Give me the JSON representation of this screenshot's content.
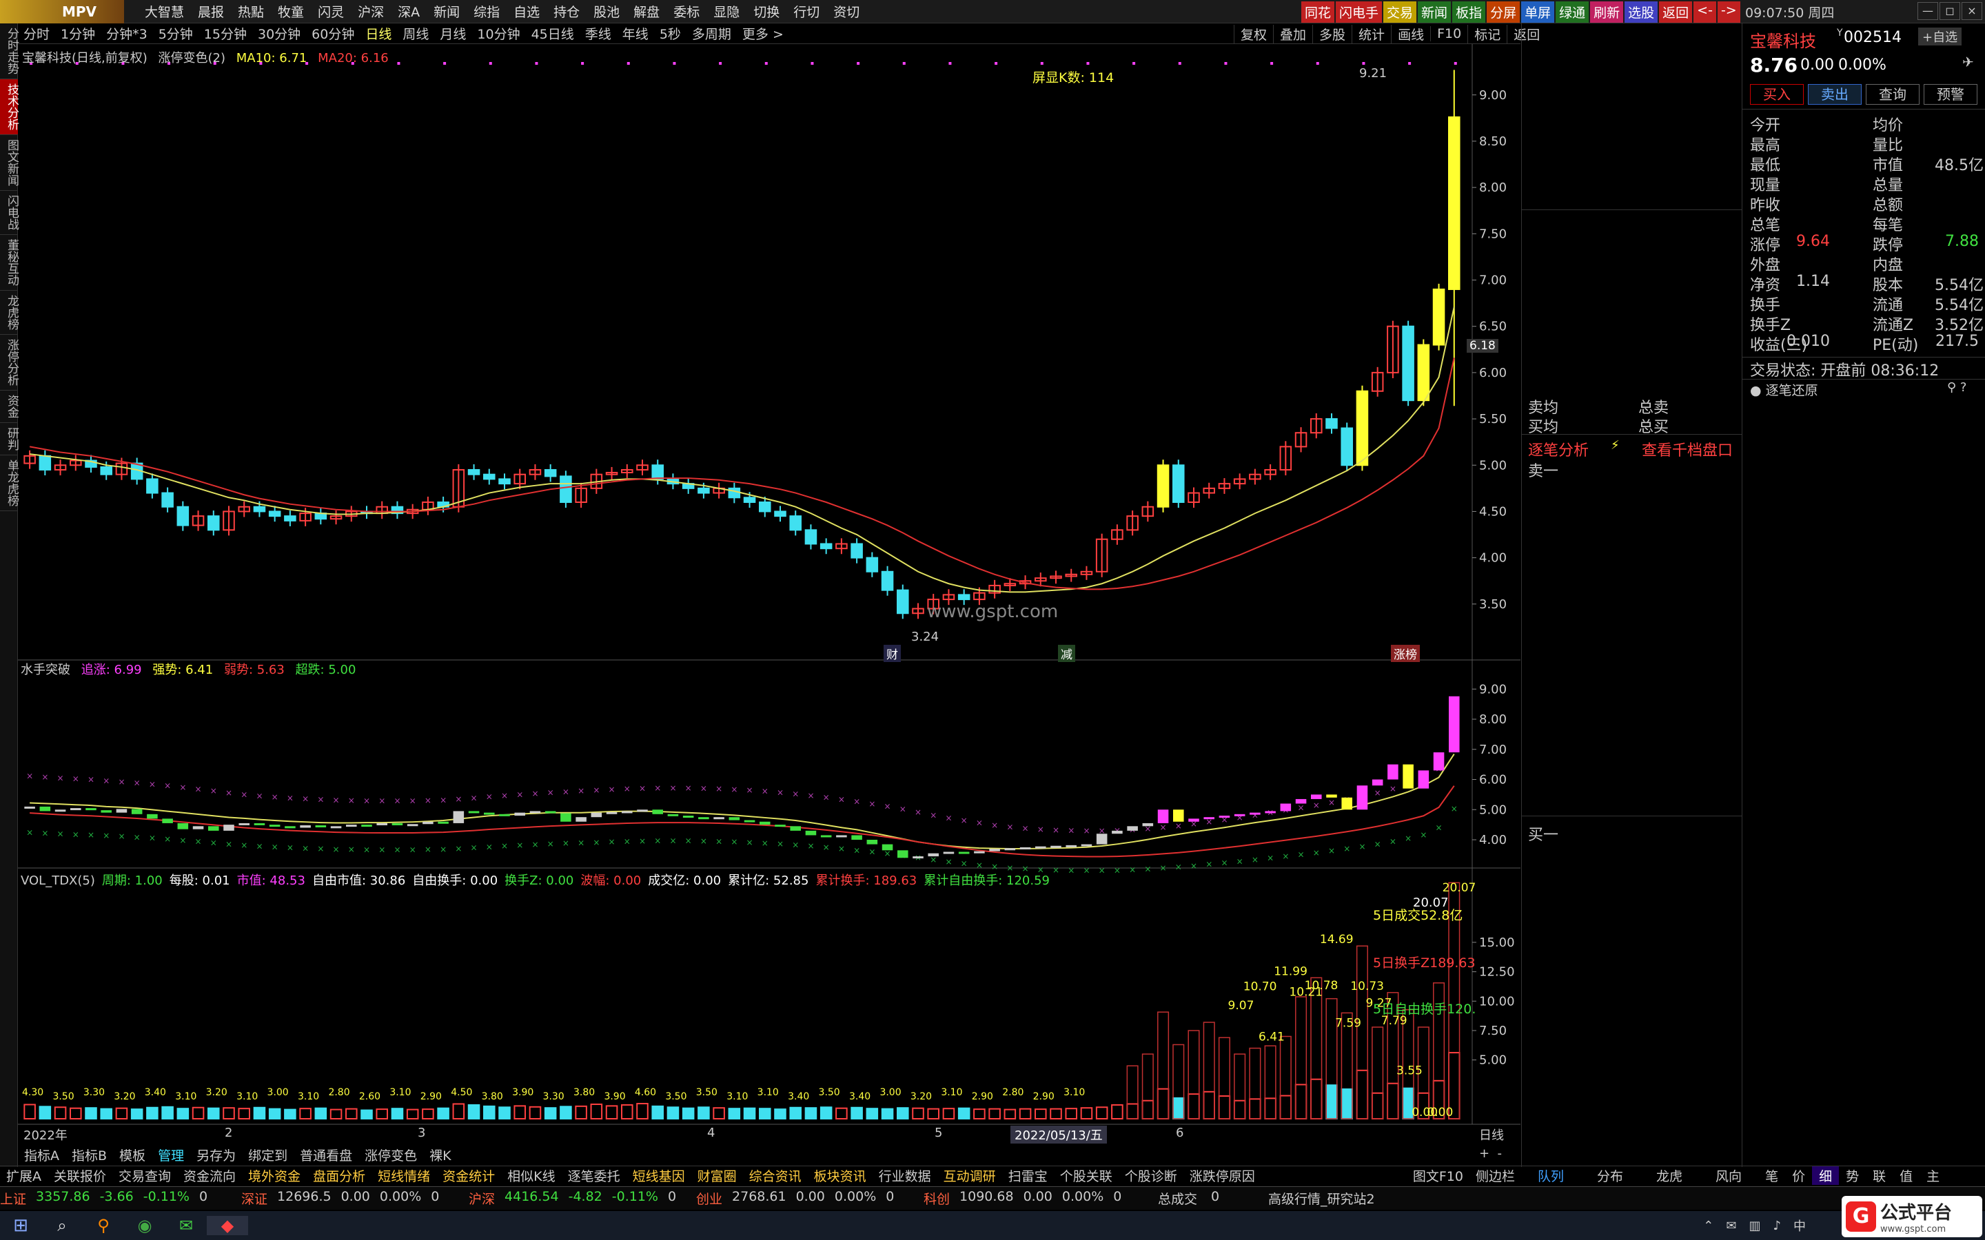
{
  "app": {
    "logo": "MPV",
    "clock": "09:07:50 周四",
    "win_min": "—",
    "win_max": "◻",
    "win_close": "×"
  },
  "menu": [
    "大智慧",
    "晨报",
    "热點",
    "牧童",
    "闪灵",
    "沪深",
    "深A",
    "新闻",
    "综指",
    "自选",
    "持仓",
    "股池",
    "解盘",
    "委标",
    "显隐",
    "切换",
    "行切",
    "资切"
  ],
  "quick": [
    {
      "label": "同花",
      "bg": "#c02020"
    },
    {
      "label": "闪电手",
      "bg": "#c02020"
    },
    {
      "label": "交易",
      "bg": "#c0a000"
    },
    {
      "label": "新闻",
      "bg": "#207020"
    },
    {
      "label": "板指",
      "bg": "#207020"
    },
    {
      "label": "分屏",
      "bg": "#c04000"
    },
    {
      "label": "单屏",
      "bg": "#2060c0"
    },
    {
      "label": "绿通",
      "bg": "#207020"
    },
    {
      "label": "刷新",
      "bg": "#c02060"
    },
    {
      "label": "选股",
      "bg": "#4040c0"
    },
    {
      "label": "返回",
      "bg": "#c02020"
    },
    {
      "label": "<-",
      "bg": "#c02020"
    },
    {
      "label": "->",
      "bg": "#c02020"
    }
  ],
  "vtabs": [
    "分时走势",
    "技术分析",
    "图文新闻",
    "闪电战",
    "董秘互动",
    "龙虎榜",
    "涨停分析",
    "资金",
    "研判",
    "单龙虎榜"
  ],
  "periods": [
    "分时",
    "1分钟",
    "分钟*3",
    "5分钟",
    "15分钟",
    "30分钟",
    "60分钟",
    "日线",
    "周线",
    "月线",
    "10分钟",
    "45日线",
    "季线",
    "年线",
    "5秒",
    "多周期",
    "更多 >"
  ],
  "tools": [
    "复权",
    "叠加",
    "多股",
    "统计",
    "画线",
    "F10",
    "标记",
    "返回"
  ],
  "main": {
    "title": "宝馨科技(日线,前复权)",
    "indicator": "涨停变色(2)",
    "ma10": "MA10: 6.71",
    "ma20": "MA20: 6.16",
    "kcount": "屏显K数: 114",
    "hi_label": "9.21",
    "lo_label": "3.24",
    "price_tag": "6.18",
    "watermark": "www.gspt.com",
    "mark_cai": "财",
    "mark_jian": "减",
    "mark_zt": "涨榜"
  },
  "mid": {
    "title": "水手突破",
    "l1": "追涨: 6.99",
    "l2": "强势: 6.41",
    "l3": "弱势: 5.63",
    "l4": "超跌: 5.00"
  },
  "vol": {
    "items": [
      {
        "t": "VOL_TDX(5)",
        "c": "#ccc"
      },
      {
        "t": "周期: 1.00",
        "c": "#40e040"
      },
      {
        "t": "每股: 0.01",
        "c": "#fff"
      },
      {
        "t": "市值: 48.53",
        "c": "#ff40ff"
      },
      {
        "t": "自由市值: 30.86",
        "c": "#fff"
      },
      {
        "t": "自由换手: 0.00",
        "c": "#fff"
      },
      {
        "t": "换手Z: 0.00",
        "c": "#40e040"
      },
      {
        "t": "波幅: 0.00",
        "c": "#ff4040"
      },
      {
        "t": "成交亿: 0.00",
        "c": "#fff"
      },
      {
        "t": "累计亿: 52.85",
        "c": "#fff"
      },
      {
        "t": "累计换手: 189.63",
        "c": "#ff4040"
      },
      {
        "t": "累计自由换手: 120.59",
        "c": "#40e040"
      }
    ],
    "ann1": "5日成交52.8亿",
    "ann2": "5日换手Z189.63",
    "ann3": "5日自由换手120.",
    "topval": "20.07"
  },
  "xaxis": {
    "labels": [
      "2022年",
      "2",
      "3",
      "4",
      "5",
      "6"
    ],
    "date": "2022/05/13/五",
    "right": "日线"
  },
  "chart_data": [
    {
      "type": "candlestick",
      "title": "宝馨科技(日线,前复权)",
      "yticks": [
        "9.00",
        "8.50",
        "8.00",
        "7.50",
        "7.00",
        "6.50",
        "6.00",
        "5.50",
        "5.00",
        "4.50",
        "4.00",
        "3.50"
      ],
      "ylim": [
        3.0,
        9.4
      ],
      "close": [
        5.1,
        4.95,
        5.0,
        5.05,
        4.98,
        4.9,
        5.02,
        4.85,
        4.7,
        4.55,
        4.35,
        4.45,
        4.3,
        4.5,
        4.55,
        4.5,
        4.45,
        4.4,
        4.48,
        4.42,
        4.45,
        4.5,
        4.48,
        4.55,
        4.48,
        4.52,
        4.6,
        4.55,
        4.95,
        4.9,
        4.85,
        4.8,
        4.9,
        4.95,
        4.88,
        4.6,
        4.75,
        4.9,
        4.92,
        4.95,
        5.0,
        4.85,
        4.8,
        4.75,
        4.7,
        4.75,
        4.65,
        4.6,
        4.5,
        4.45,
        4.3,
        4.15,
        4.1,
        4.15,
        4.0,
        3.85,
        3.65,
        3.4,
        3.45,
        3.55,
        3.6,
        3.55,
        3.62,
        3.7,
        3.72,
        3.75,
        3.78,
        3.8,
        3.82,
        3.85,
        4.2,
        4.3,
        4.45,
        4.55,
        5.0,
        4.6,
        4.7,
        4.75,
        4.8,
        4.85,
        4.9,
        4.95,
        5.2,
        5.35,
        5.5,
        5.4,
        5.0,
        5.8,
        6.0,
        6.5,
        5.7,
        6.3,
        6.9,
        8.76
      ],
      "ma10": [
        5.12,
        5.1,
        5.08,
        5.06,
        5.04,
        5.0,
        4.98,
        4.95,
        4.9,
        4.85,
        4.8,
        4.75,
        4.7,
        4.65,
        4.62,
        4.58,
        4.55,
        4.52,
        4.5,
        4.48,
        4.47,
        4.47,
        4.48,
        4.48,
        4.49,
        4.5,
        4.52,
        4.55,
        4.6,
        4.65,
        4.7,
        4.73,
        4.76,
        4.78,
        4.8,
        4.8,
        4.8,
        4.82,
        4.84,
        4.85,
        4.85,
        4.84,
        4.82,
        4.8,
        4.78,
        4.75,
        4.72,
        4.68,
        4.64,
        4.6,
        4.55,
        4.48,
        4.4,
        4.32,
        4.25,
        4.15,
        4.05,
        3.95,
        3.85,
        3.78,
        3.72,
        3.68,
        3.65,
        3.64,
        3.63,
        3.63,
        3.64,
        3.65,
        3.66,
        3.68,
        3.72,
        3.78,
        3.85,
        3.93,
        4.02,
        4.1,
        4.18,
        4.25,
        4.32,
        4.4,
        4.48,
        4.55,
        4.62,
        4.7,
        4.78,
        4.86,
        4.94,
        5.05,
        5.18,
        5.32,
        5.48,
        5.68,
        5.95,
        6.71
      ],
      "ma20": [
        5.2,
        5.17,
        5.14,
        5.12,
        5.1,
        5.07,
        5.04,
        5.01,
        4.97,
        4.93,
        4.88,
        4.83,
        4.78,
        4.73,
        4.68,
        4.64,
        4.61,
        4.58,
        4.56,
        4.54,
        4.52,
        4.51,
        4.5,
        4.5,
        4.5,
        4.5,
        4.51,
        4.52,
        4.55,
        4.58,
        4.62,
        4.65,
        4.68,
        4.71,
        4.74,
        4.76,
        4.78,
        4.8,
        4.82,
        4.84,
        4.85,
        4.86,
        4.86,
        4.86,
        4.85,
        4.84,
        4.82,
        4.8,
        4.77,
        4.74,
        4.7,
        4.65,
        4.6,
        4.54,
        4.48,
        4.42,
        4.35,
        4.27,
        4.18,
        4.1,
        4.02,
        3.95,
        3.88,
        3.82,
        3.77,
        3.73,
        3.7,
        3.68,
        3.67,
        3.66,
        3.66,
        3.67,
        3.69,
        3.72,
        3.76,
        3.8,
        3.85,
        3.91,
        3.97,
        4.03,
        4.1,
        4.17,
        4.24,
        4.31,
        4.38,
        4.46,
        4.54,
        4.63,
        4.73,
        4.84,
        4.96,
        5.1,
        5.4,
        6.16
      ]
    },
    {
      "type": "indicator",
      "title": "水手突破",
      "yticks": [
        "9.00",
        "8.00",
        "7.00",
        "6.00",
        "5.00",
        "4.00"
      ],
      "ylim": [
        3.2,
        9.6
      ],
      "series": [
        {
          "name": "追涨",
          "last": 6.99
        },
        {
          "name": "强势",
          "last": 6.41
        },
        {
          "name": "弱势",
          "last": 5.63
        },
        {
          "name": "超跌",
          "last": 5.0
        }
      ]
    },
    {
      "type": "bar",
      "title": "VOL_TDX(5)",
      "yticks": [
        "15.00",
        "12.50",
        "10.00",
        "7.50",
        "5.00"
      ],
      "ylim": [
        0,
        20.5
      ],
      "values": [
        4.3,
        3.7,
        3.5,
        3.2,
        3.3,
        3.0,
        3.2,
        2.9,
        3.4,
        3.6,
        3.1,
        3.4,
        3.2,
        3.3,
        3.1,
        3.4,
        3.0,
        2.8,
        3.1,
        3.2,
        2.8,
        3.0,
        2.6,
        2.9,
        3.1,
        2.8,
        2.9,
        3.2,
        4.5,
        4.2,
        3.8,
        3.5,
        3.9,
        3.6,
        3.3,
        3.7,
        3.8,
        4.4,
        3.9,
        4.2,
        4.6,
        3.8,
        3.5,
        3.2,
        3.5,
        3.3,
        3.1,
        3.2,
        3.1,
        2.9,
        3.4,
        3.3,
        3.5,
        3.2,
        3.4,
        3.1,
        3.0,
        3.3,
        3.2,
        3.0,
        3.1,
        3.2,
        2.9,
        3.0,
        2.8,
        3.0,
        2.9,
        3.0,
        3.1,
        3.3,
        3.5,
        4.2,
        4.5,
        5.5,
        9.07,
        6.3,
        7.5,
        8.2,
        6.9,
        5.5,
        6.0,
        6.2,
        7.0,
        10.37,
        11.99,
        10.21,
        9.0,
        14.69,
        7.79,
        10.73,
        9.27,
        7.79,
        11.55,
        20.07
      ],
      "labels": [
        "9.07",
        "10.70",
        "6.41",
        "11.99",
        "10.21",
        "10.78",
        "14.69",
        "7.59",
        "10.73",
        "9.27",
        "7.79",
        "3.55",
        "0.00",
        "0.00",
        "20.07"
      ]
    }
  ],
  "rp": {
    "name": "宝馨科技",
    "code": "002514",
    "code_prefix": "Y",
    "zixuan": "+自选",
    "price": "8.76",
    "chg": "0.00",
    "pct": "0.00%",
    "btn_buy": "买入",
    "btn_sell": "卖出",
    "btn_query": "查询",
    "btn_warn": "预警",
    "rows": [
      [
        "今开",
        "",
        "均价",
        ""
      ],
      [
        "最高",
        "",
        "量比",
        ""
      ],
      [
        "最低",
        "",
        "市值",
        "48.5亿"
      ],
      [
        "现量",
        "",
        "总量",
        ""
      ],
      [
        "昨收",
        "",
        "总额",
        ""
      ],
      [
        "总笔",
        "",
        "每笔",
        ""
      ],
      [
        "涨停",
        "9.64",
        "跌停",
        "7.88"
      ],
      [
        "外盘",
        "",
        "内盘",
        ""
      ],
      [
        "净资",
        "1.14",
        "股本",
        "5.54亿"
      ],
      [
        "换手",
        "",
        "流通",
        "5.54亿"
      ],
      [
        "换手Z",
        "",
        "流通Z",
        "3.52亿"
      ],
      [
        "收益(三)",
        "0.010",
        "PE(动)",
        "217.5"
      ]
    ],
    "status": "交易状态: 开盘前 08:36:12",
    "zbhy": "逐笔还原",
    "sell_avg": "卖均",
    "buy_avg": "买均",
    "total_sell": "总卖",
    "total_buy": "总买",
    "zbfx": "逐笔分析",
    "qtpk": "查看千档盘口",
    "sell1": "卖一",
    "buy1": "买一"
  },
  "bottom1": [
    "指标A",
    "指标B",
    "模板",
    "管理",
    "另存为",
    "绑定到",
    "普通看盘",
    "涨停变色",
    "裸K"
  ],
  "bottom2": [
    "扩展A",
    "关联报价",
    "交易查询",
    "资金流向",
    "境外资金",
    "盘面分析",
    "短线情绪",
    "资金统计",
    "相似K线",
    "逐笔委托",
    "短线基因",
    "财富圈",
    "综合资讯",
    "板块资讯",
    "行业数据",
    "互动调研",
    "扫雷宝",
    "个股关联",
    "个股诊断",
    "涨跌停原因",
    "图文F10",
    "侧边栏"
  ],
  "rtabs": [
    "队列",
    "分布",
    "龙虎",
    "风向",
    "笔",
    "价",
    "细",
    "势",
    "联",
    "值",
    "主"
  ],
  "ticker": {
    "items": [
      {
        "name": "上证",
        "v": "3357.86",
        "c": "-3.66",
        "p": "-0.11%",
        "x": "0"
      },
      {
        "name": "深证",
        "v": "12696.5",
        "c": "0.00",
        "p": "0.00%",
        "x": "0"
      },
      {
        "name": "沪深",
        "v": "4416.54",
        "c": "-4.82",
        "p": "-0.11%",
        "x": "0"
      },
      {
        "name": "创业",
        "v": "2768.61",
        "c": "0.00",
        "p": "0.00%",
        "x": "0"
      },
      {
        "name": "科创",
        "v": "1090.68",
        "c": "0.00",
        "p": "0.00%",
        "x": "0"
      }
    ],
    "total": "总成交",
    "total_v": "0",
    "right": "高级行情_研究站2"
  },
  "brand": {
    "main": "公式平台",
    "sub": "www.gspt.com"
  }
}
